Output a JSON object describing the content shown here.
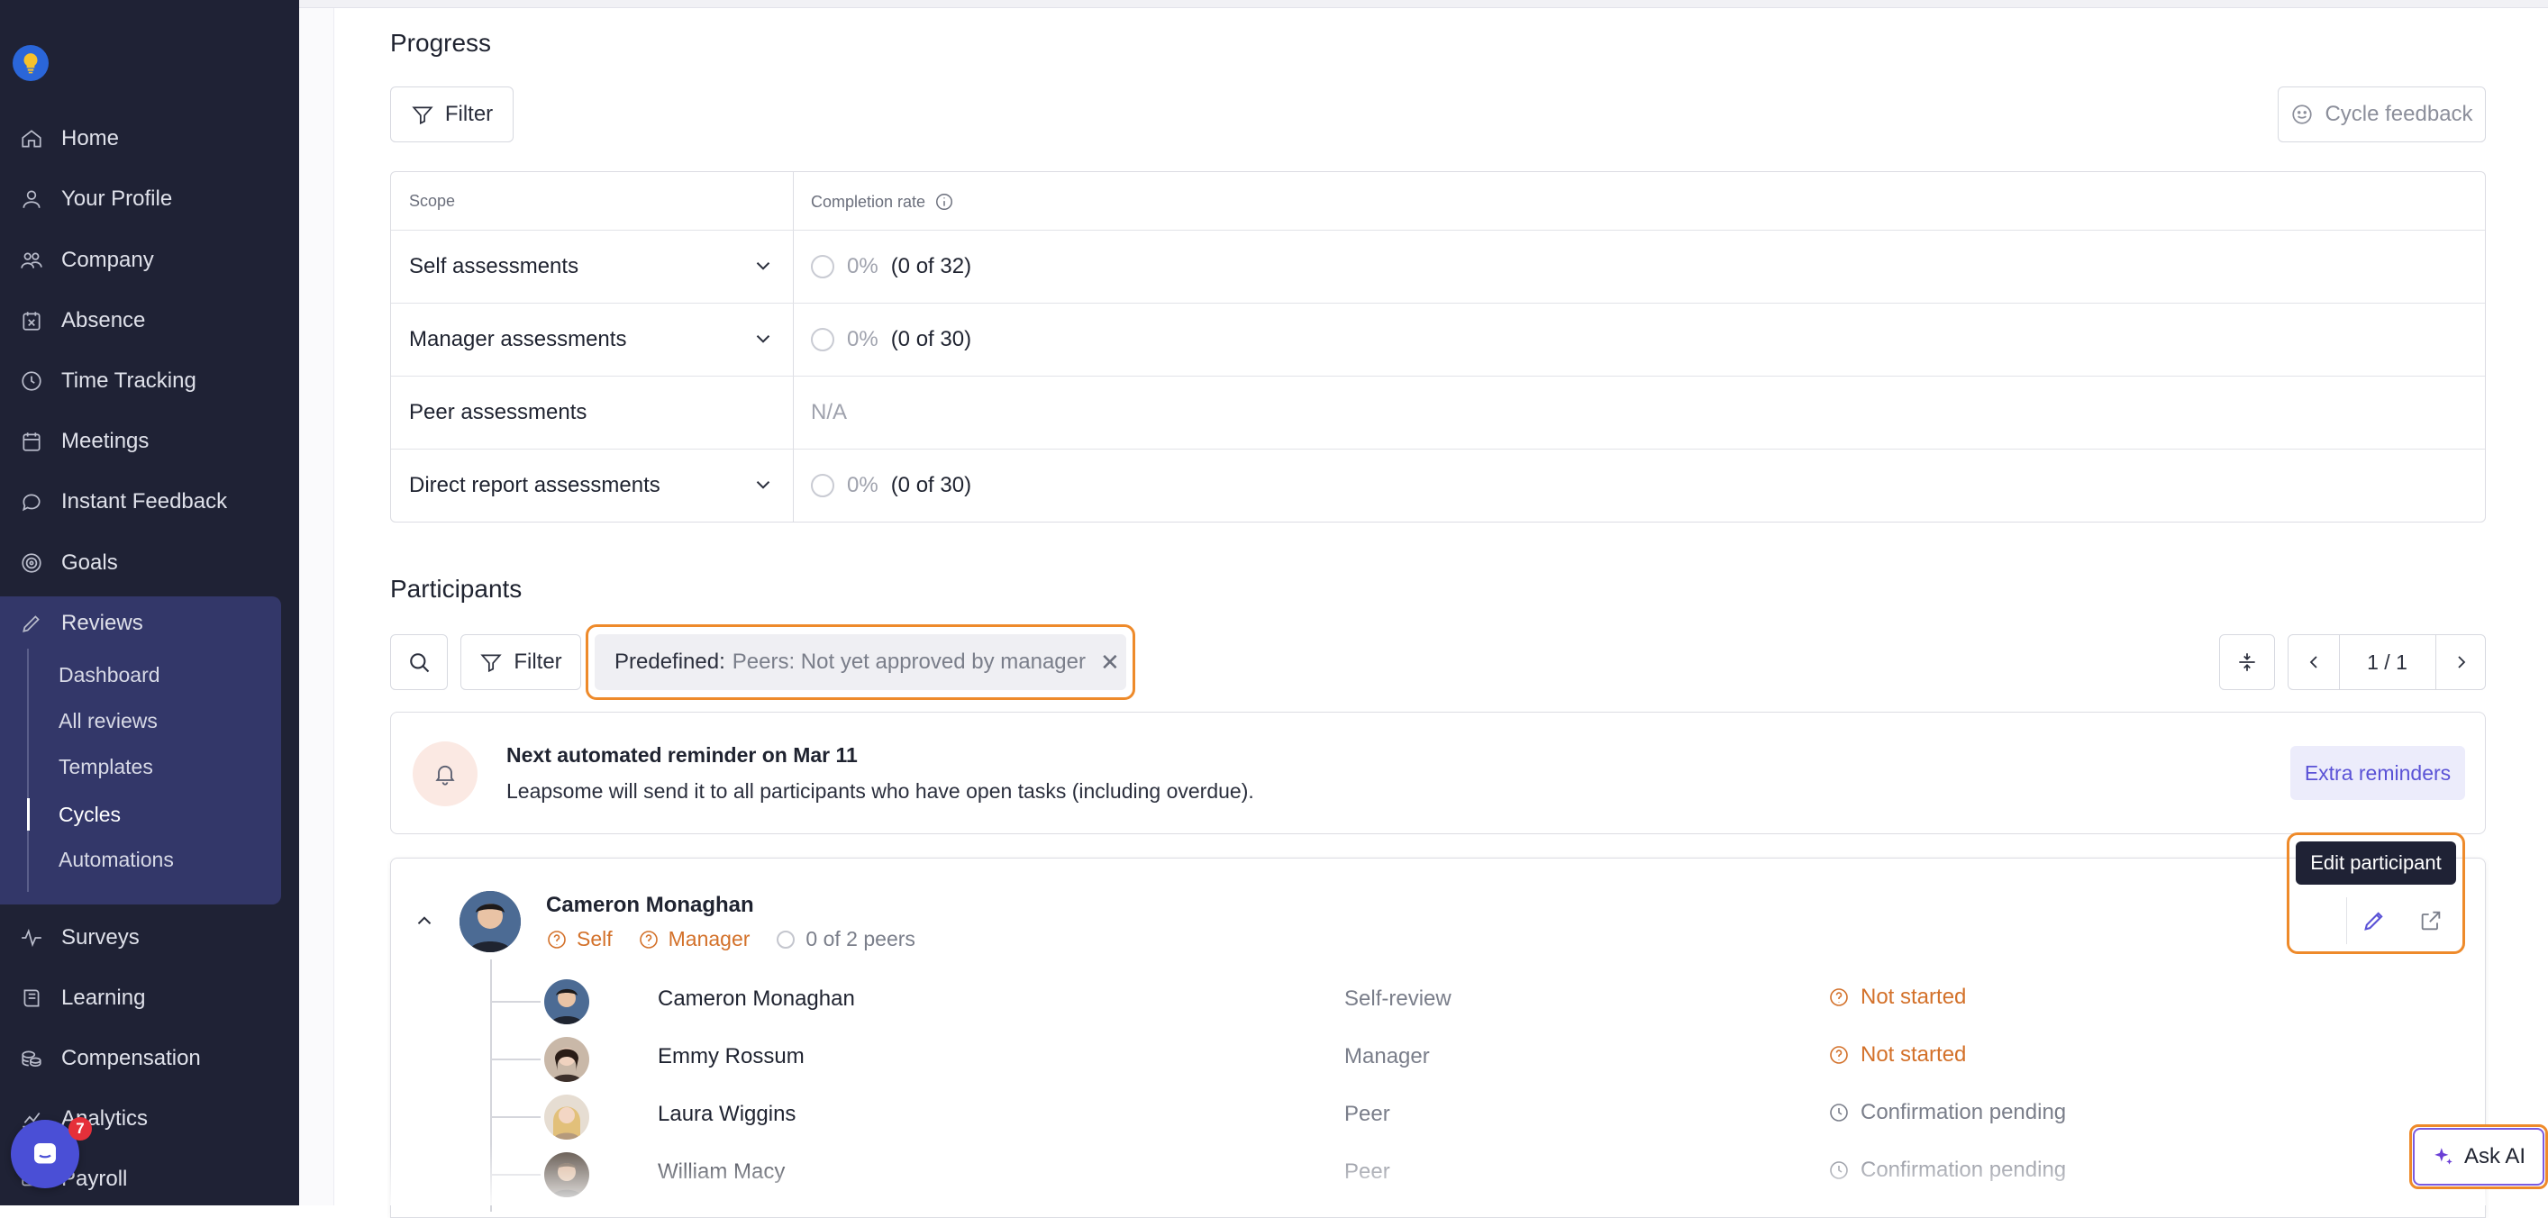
{
  "sidebar": {
    "nav": [
      {
        "label": "Home",
        "icon": "home-icon"
      },
      {
        "label": "Your Profile",
        "icon": "user-icon"
      },
      {
        "label": "Company",
        "icon": "people-icon"
      },
      {
        "label": "Absence",
        "icon": "calendar-x-icon"
      },
      {
        "label": "Time Tracking",
        "icon": "clock-icon"
      },
      {
        "label": "Meetings",
        "icon": "calendar-icon"
      },
      {
        "label": "Instant Feedback",
        "icon": "chat-icon"
      },
      {
        "label": "Goals",
        "icon": "target-icon"
      },
      {
        "label": "Reviews",
        "icon": "pencil-icon"
      }
    ],
    "reviews_sub": [
      "Dashboard",
      "All reviews",
      "Templates",
      "Cycles",
      "Automations"
    ],
    "nav_bottom": [
      {
        "label": "Surveys",
        "icon": "pulse-icon"
      },
      {
        "label": "Learning",
        "icon": "book-icon"
      },
      {
        "label": "Compensation",
        "icon": "coins-icon"
      },
      {
        "label": "Analytics",
        "icon": "chart-icon"
      },
      {
        "label": "Payroll",
        "icon": "payroll-icon"
      }
    ],
    "intercom_badge": "7"
  },
  "progress": {
    "title": "Progress",
    "filter_label": "Filter",
    "cycle_feedback_label": "Cycle feedback",
    "col_scope": "Scope",
    "col_completion": "Completion rate",
    "rows": [
      {
        "scope": "Self assessments",
        "pct": "0%",
        "count": "(0 of 32)",
        "expandable": true
      },
      {
        "scope": "Manager assessments",
        "pct": "0%",
        "count": "(0 of 30)",
        "expandable": true
      },
      {
        "scope": "Peer assessments",
        "na": "N/A",
        "expandable": false
      },
      {
        "scope": "Direct report assessments",
        "pct": "0%",
        "count": "(0 of 30)",
        "expandable": true
      }
    ]
  },
  "participants": {
    "title": "Participants",
    "filter_label": "Filter",
    "chip_key": "Predefined:",
    "chip_value": "Peers: Not yet approved by manager",
    "pager": "1 / 1",
    "reminder_title": "Next automated reminder on Mar 11",
    "reminder_text": "Leapsome will send it to all participants who have open tasks (including overdue).",
    "extra_reminders": "Extra reminders",
    "tooltip": "Edit participant",
    "person": {
      "name": "Cameron Monaghan",
      "self": "Self",
      "manager": "Manager",
      "peers": "0 of 2 peers"
    },
    "reviewers": [
      {
        "name": "Cameron Monaghan",
        "role": "Self-review",
        "status": "Not started",
        "state": "warn"
      },
      {
        "name": "Emmy Rossum",
        "role": "Manager",
        "status": "Not started",
        "state": "warn"
      },
      {
        "name": "Laura Wiggins",
        "role": "Peer",
        "status": "Confirmation pending",
        "state": "pending"
      },
      {
        "name": "William Macy",
        "role": "Peer",
        "status": "Confirmation pending",
        "state": "pending"
      }
    ]
  },
  "ask_ai": "Ask AI",
  "colors": {
    "accent_orange": "#ee8a2a",
    "sidebar_bg": "#1f2235",
    "status_orange": "#d3712a",
    "primary": "#5a52d6"
  }
}
